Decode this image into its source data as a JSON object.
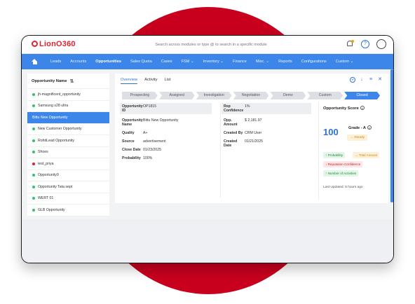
{
  "app": {
    "logo": "LionO360",
    "search_placeholder": "Search across modules or type @ to search in a specific module"
  },
  "nav": {
    "items": [
      {
        "label": "Leads"
      },
      {
        "label": "Accounts"
      },
      {
        "label": "Opportunities",
        "active": true
      },
      {
        "label": "Sales Quota"
      },
      {
        "label": "Cases"
      },
      {
        "label": "FSM ⌄"
      },
      {
        "label": "Inventory ⌄"
      },
      {
        "label": "Finance"
      },
      {
        "label": "Misc. ⌄"
      },
      {
        "label": "Reports"
      },
      {
        "label": "Configurations"
      },
      {
        "label": "Custom ⌄"
      }
    ]
  },
  "list": {
    "header": "Opportunity Name",
    "items": [
      {
        "name": "jh-magnificent_opportunity",
        "status": "green"
      },
      {
        "name": "Samsung s28 ultra",
        "status": "green"
      },
      {
        "name": "Bittu New Opportunity",
        "status": "selected"
      },
      {
        "name": "New Customer Opportunity",
        "status": "green"
      },
      {
        "name": "RohitLead Opportunity",
        "status": "green"
      },
      {
        "name": "Shoes",
        "status": "green"
      },
      {
        "name": "test_priya",
        "status": "red"
      },
      {
        "name": "Opportunity9",
        "status": "green"
      },
      {
        "name": "Opportunity Tata sept",
        "status": "green"
      },
      {
        "name": "WERT 01",
        "status": "green"
      },
      {
        "name": "GLB Opportunity",
        "status": "green"
      }
    ]
  },
  "detail": {
    "tabs": [
      {
        "label": "Overview",
        "active": true
      },
      {
        "label": "Activity"
      },
      {
        "label": "List"
      }
    ],
    "stages": [
      {
        "label": "Prospecting"
      },
      {
        "label": "Assigned"
      },
      {
        "label": "Investigation"
      },
      {
        "label": "Negotiation"
      },
      {
        "label": "Demo"
      },
      {
        "label": "Custom"
      },
      {
        "label": "Closed",
        "active": true
      }
    ],
    "left_fields": [
      {
        "label": "Opportunity ID",
        "value": "OP1815"
      },
      {
        "label": "Opportunity Name",
        "value": "Bittu New Opportunity"
      },
      {
        "label": "Quality",
        "value": "A+"
      },
      {
        "label": "Source",
        "value": "advertisement"
      },
      {
        "label": "Close Date",
        "value": "01/23/2025"
      },
      {
        "label": "Probability",
        "value": "100%"
      }
    ],
    "right_fields": [
      {
        "label": "Rep Confidence",
        "value": "1%"
      },
      {
        "label": "Opp. Amount",
        "value": "$ 2,181.97"
      },
      {
        "label": "Created By",
        "value": "CRM User"
      },
      {
        "label": "Created Date",
        "value": "01/21/2025"
      }
    ],
    "score": {
      "title": "Opportunity Score",
      "value": "100",
      "grade": "Grade - A",
      "trend": "→ Steady",
      "chips": [
        {
          "label": "↑ Probability",
          "color": "green"
        },
        {
          "label": "→ Total Amount",
          "color": "orange"
        },
        {
          "label": "↓ Reputation Confidence",
          "color": "red"
        },
        {
          "label": "↑ Number of Activities",
          "color": "green"
        }
      ],
      "updated": "Last Updated: 5 hours ago"
    }
  },
  "colors": {
    "brand_red": "#e2202f",
    "primary_blue": "#3d86e9",
    "background_circle": "#c8001e"
  }
}
